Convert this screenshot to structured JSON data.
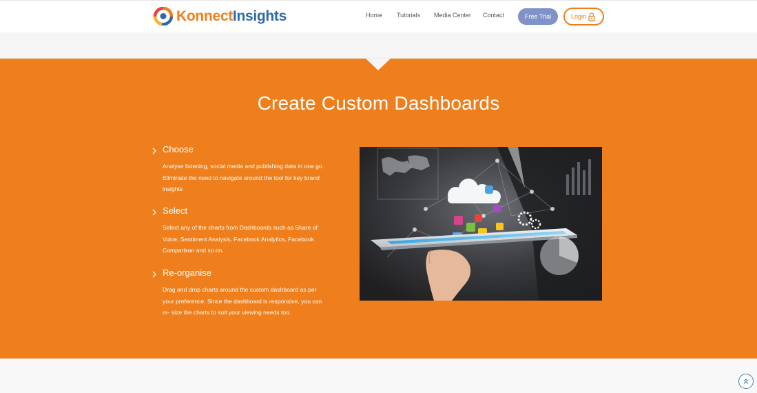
{
  "brand": {
    "name_part1": "Konnect",
    "name_part2": "Insights",
    "colors": {
      "orange": "#ef7f1c",
      "blue": "#2f6aa8",
      "trial_button": "#7f92c9"
    }
  },
  "nav": {
    "items": [
      {
        "label": "Home"
      },
      {
        "label": "Tutorials"
      },
      {
        "label": "Media Center"
      },
      {
        "label": "Contact"
      }
    ],
    "trial_label": "Free Trial",
    "login_label": "Login",
    "login_icon": "lock-icon"
  },
  "section": {
    "title": "Create Custom Dashboards",
    "features": [
      {
        "heading": "Choose",
        "text": "Analyse listening, social media and publishing data in one go. Eliminate the need to navigate around the tool for key brand insights"
      },
      {
        "heading": "Select",
        "text": "Select any of the charts from Dashboards such as Share of Voice, Sentiment Analysis, Facebook Analytics, Facebook Comparison and so on."
      },
      {
        "heading": "Re-organise",
        "text": "Drag and drop charts around the custom dashboard as per your preference. Since the dashboard is responsive, you can re- size the charts to suit your viewing needs too."
      }
    ],
    "hero_image": "hand-holding-tablet-with-cloud-and-app-icons"
  },
  "scroll_top_icon": "double-chevron-up-icon"
}
